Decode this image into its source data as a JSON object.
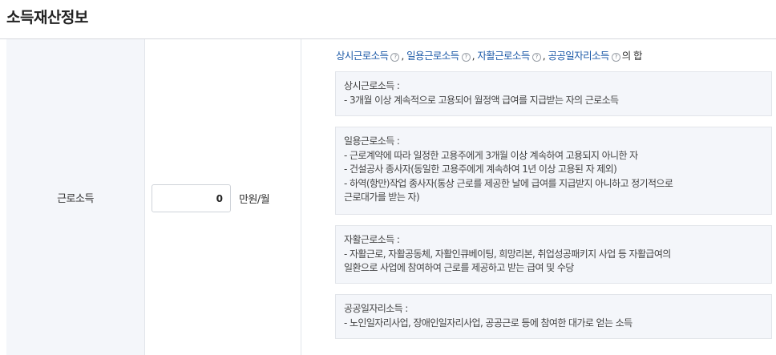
{
  "section": {
    "title": "소득재산정보"
  },
  "row": {
    "label": "근로소득",
    "input_value": "0",
    "unit": "만원/월"
  },
  "summary": {
    "links": [
      "상시근로소득",
      "일용근로소득",
      "자활근로소득",
      "공공일자리소득"
    ],
    "separator": ",",
    "suffix": "의 합",
    "info_glyph": "?"
  },
  "definitions": [
    {
      "term": "상시근로소득 :",
      "items": [
        "- 3개월 이상 계속적으로 고용되어 월정액 급여를 지급받는 자의 근로소득"
      ]
    },
    {
      "term": "일용근로소득 :",
      "items": [
        "- 근로계약에 따라 일정한 고용주에게 3개월 이상 계속하여 고용되지 아니한 자",
        "- 건설공사 종사자(동일한 고용주에게 계속하여 1년 이상 고용된 자 제외)",
        "- 하역(항만)작업 종사자(통상 근로를 제공한 날에 급여를 지급받지 아니하고 정기적으로",
        "근로대가를 받는 자)"
      ]
    },
    {
      "term": "자활근로소득 :",
      "items": [
        "- 자활근로, 자활공동체, 자활인큐베이팅, 희망리본, 취업성공패키지 사업 등 자활급여의",
        "일환으로 사업에 참여하여 근로를 제공하고 받는 급여 및 수당"
      ]
    },
    {
      "term": "공공일자리소득 :",
      "items": [
        "- 노인일자리사업, 장애인일자리사업, 공공근로 등에 참여한 대가로 얻는 소득"
      ]
    }
  ]
}
